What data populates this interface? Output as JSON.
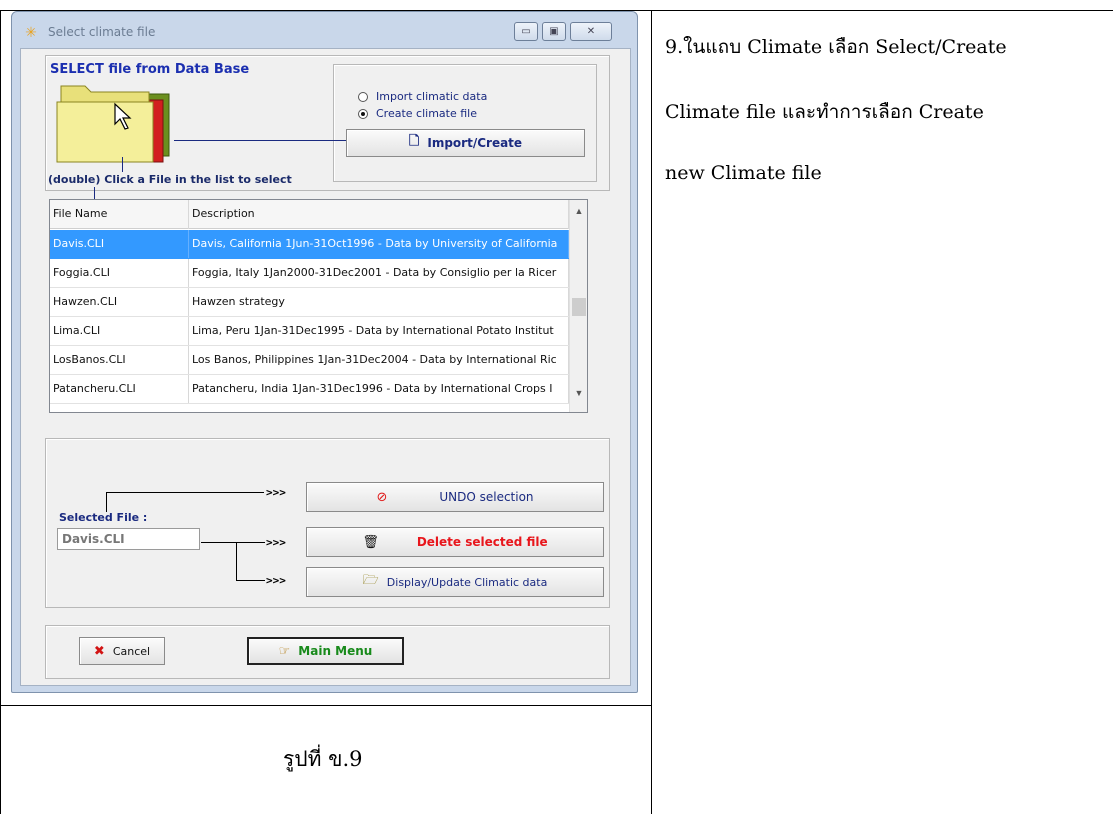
{
  "window": {
    "title": "Select climate file",
    "minimize_icon": "minimize-icon",
    "maximize_icon": "maximize-icon",
    "close_icon": "close-icon"
  },
  "database": {
    "heading": "SELECT file from Data Base",
    "instruction": "(double) Click a File in the list to select",
    "options": [
      {
        "label": "Import climatic data",
        "selected": false
      },
      {
        "label": "Create climate file",
        "selected": true
      }
    ],
    "import_create_label": "Import/Create"
  },
  "file_table": {
    "columns": [
      "File Name",
      "Description"
    ],
    "rows": [
      {
        "name": "Davis.CLI",
        "description": "Davis, California 1Jun-31Oct1996 - Data by University of California",
        "selected": true
      },
      {
        "name": "Foggia.CLI",
        "description": "Foggia, Italy 1Jan2000-31Dec2001 - Data by Consiglio per la Ricer",
        "selected": false
      },
      {
        "name": "Hawzen.CLI",
        "description": "Hawzen strategy",
        "selected": false
      },
      {
        "name": "Lima.CLI",
        "description": "Lima, Peru 1Jan-31Dec1995 - Data by International Potato Institut",
        "selected": false
      },
      {
        "name": "LosBanos.CLI",
        "description": "Los Banos, Philippines 1Jan-31Dec2004 - Data by International Ric",
        "selected": false
      },
      {
        "name": "Patancheru.CLI",
        "description": "Patancheru, India 1Jan-31Dec1996 - Data by International Crops I",
        "selected": false
      }
    ]
  },
  "selection": {
    "arrow_text": ">>>",
    "selected_file_label": "Selected File :",
    "selected_file_value": "Davis.CLI",
    "undo_label": "UNDO selection",
    "delete_label": "Delete selected file",
    "display_label": "Display/Update Climatic data",
    "delete_color": "#e8161c"
  },
  "footer": {
    "cancel_label": "Cancel",
    "main_menu_label": "Main Menu",
    "main_menu_color": "#188a1b"
  },
  "document": {
    "caption": "รูปที่ ข.9",
    "instruction_lines": [
      "9.ในแถบ Climate เลือก Select/Create",
      "Climate file และทำการเลือก Create",
      "new Climate file"
    ]
  }
}
